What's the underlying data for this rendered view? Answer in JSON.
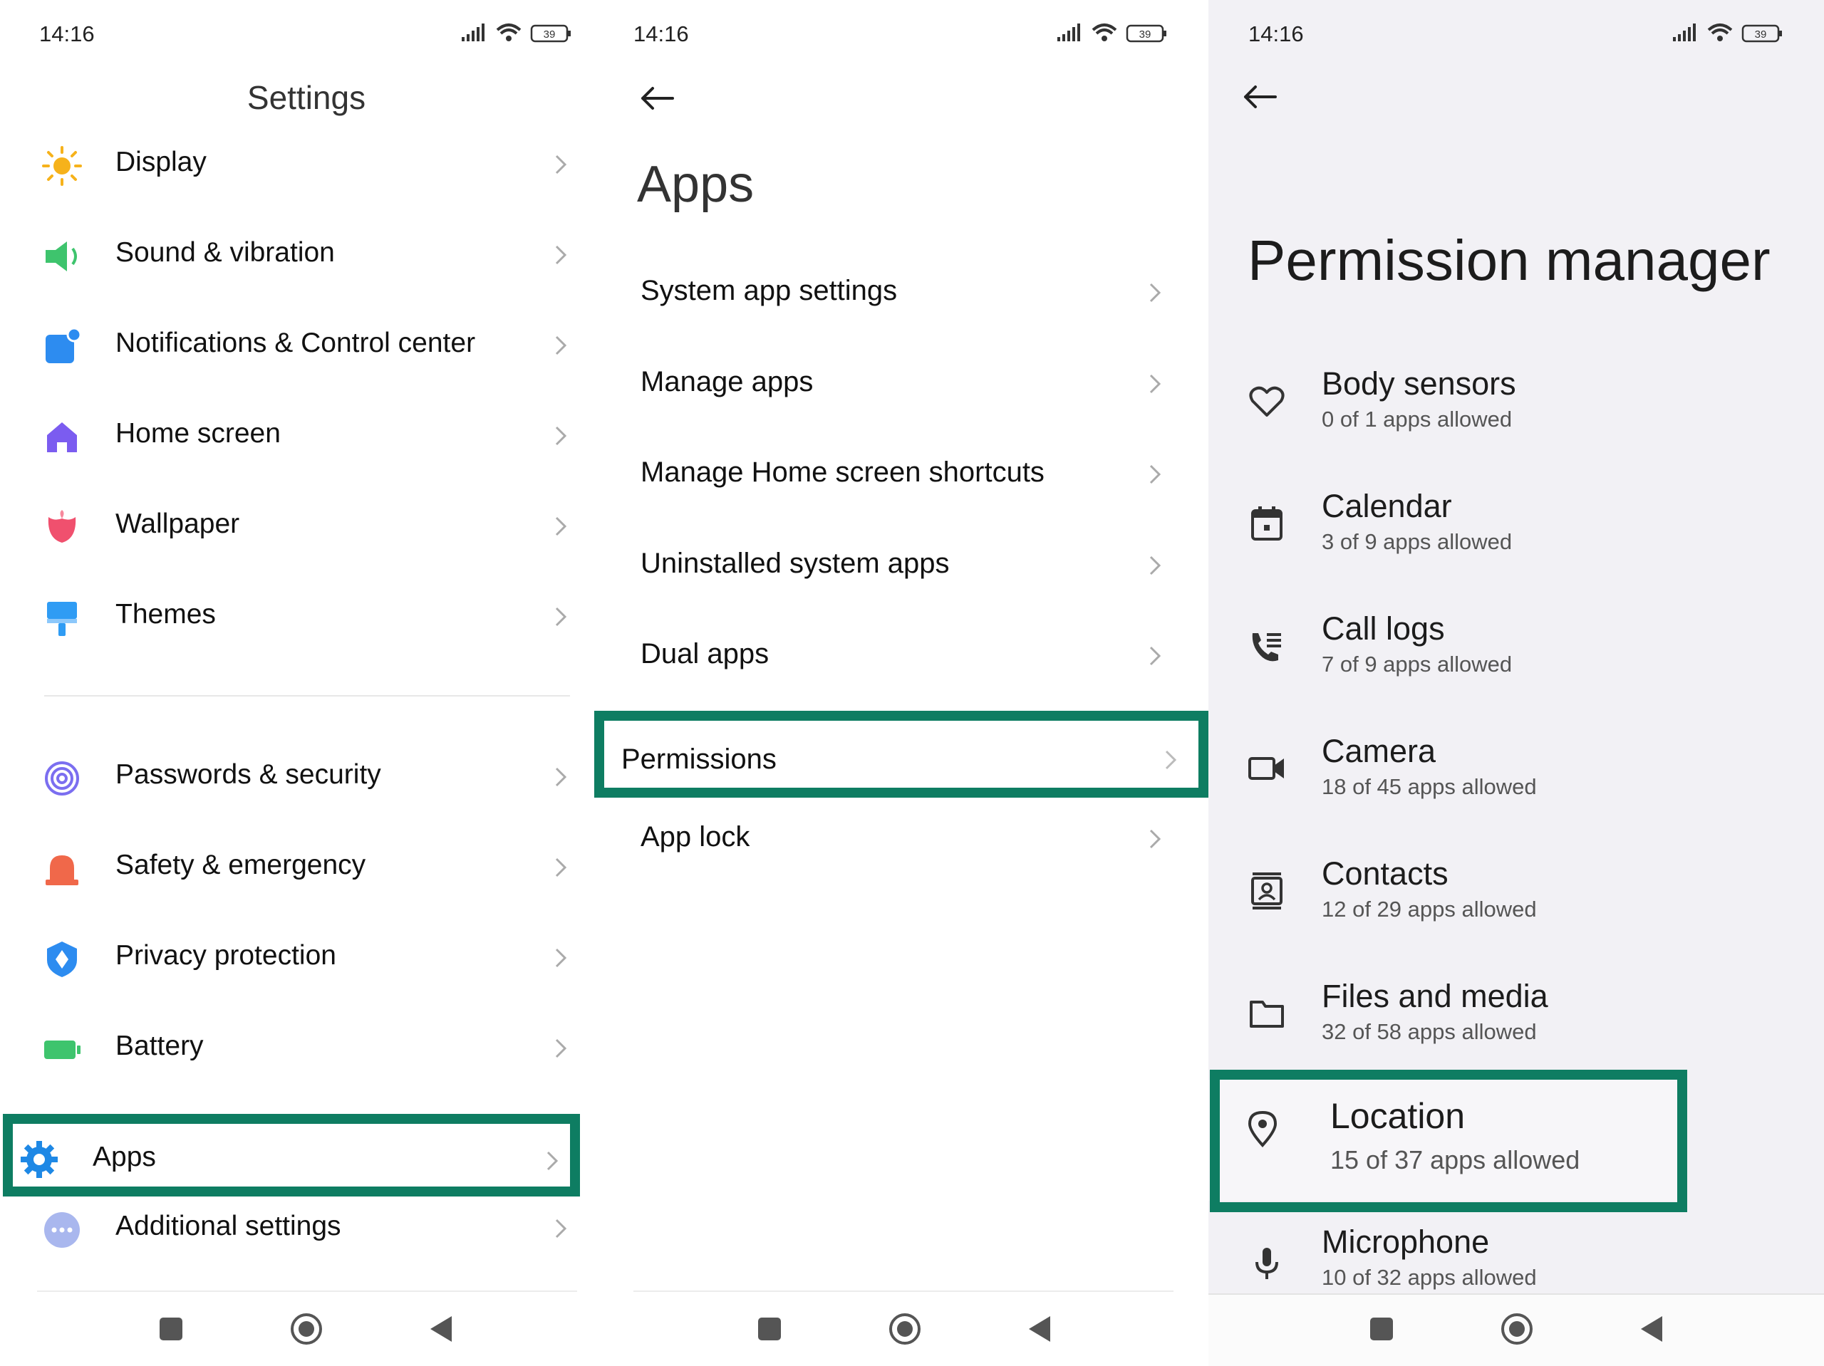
{
  "status": {
    "time": "14:16",
    "battery": "39"
  },
  "settings": {
    "title": "Settings",
    "items": [
      {
        "label": "Display",
        "icon": "sun-icon",
        "color": "#f6b21b"
      },
      {
        "label": "Sound & vibration",
        "icon": "speaker-icon",
        "color": "#3ec46d"
      },
      {
        "label": "Notifications & Control center",
        "icon": "notification-icon",
        "color": "#2d8cf0"
      },
      {
        "label": "Home screen",
        "icon": "home-icon",
        "color": "#7b5cf0"
      },
      {
        "label": "Wallpaper",
        "icon": "tulip-icon",
        "color": "#f0506e"
      },
      {
        "label": "Themes",
        "icon": "brush-icon",
        "color": "#2f9cf4"
      },
      {
        "label": "Passwords & security",
        "icon": "fingerprint-icon",
        "color": "#7b6ef0"
      },
      {
        "label": "Safety & emergency",
        "icon": "alarm-icon",
        "color": "#f0684a"
      },
      {
        "label": "Privacy protection",
        "icon": "shield-icon",
        "color": "#2d8cf0"
      },
      {
        "label": "Battery",
        "icon": "battery-icon",
        "color": "#3ec46d"
      },
      {
        "label": "Apps",
        "icon": "gear-icon",
        "color": "#1e88e5"
      },
      {
        "label": "Additional settings",
        "icon": "more-icon",
        "color": "#8fa2e8"
      }
    ]
  },
  "apps": {
    "title": "Apps",
    "items": [
      {
        "label": "System app settings"
      },
      {
        "label": "Manage apps"
      },
      {
        "label": "Manage Home screen shortcuts"
      },
      {
        "label": "Uninstalled system apps"
      },
      {
        "label": "Dual apps"
      },
      {
        "label": "Permissions"
      },
      {
        "label": "App lock"
      }
    ]
  },
  "permission_manager": {
    "title": "Permission manager",
    "items": [
      {
        "name": "Body sensors",
        "sub": "0 of 1 apps allowed",
        "icon": "heart-icon"
      },
      {
        "name": "Calendar",
        "sub": "3 of 9 apps allowed",
        "icon": "calendar-icon"
      },
      {
        "name": "Call logs",
        "sub": "7 of 9 apps allowed",
        "icon": "call-log-icon"
      },
      {
        "name": "Camera",
        "sub": "18 of 45 apps allowed",
        "icon": "camera-icon"
      },
      {
        "name": "Contacts",
        "sub": "12 of 29 apps allowed",
        "icon": "contacts-icon"
      },
      {
        "name": "Files and media",
        "sub": "32 of 58 apps allowed",
        "icon": "folder-icon"
      },
      {
        "name": "Location",
        "sub": "15 of 37 apps allowed",
        "icon": "location-pin-icon"
      },
      {
        "name": "Microphone",
        "sub": "10 of 32 apps allowed",
        "icon": "microphone-icon"
      }
    ]
  },
  "highlight_color": "#0e7d62"
}
